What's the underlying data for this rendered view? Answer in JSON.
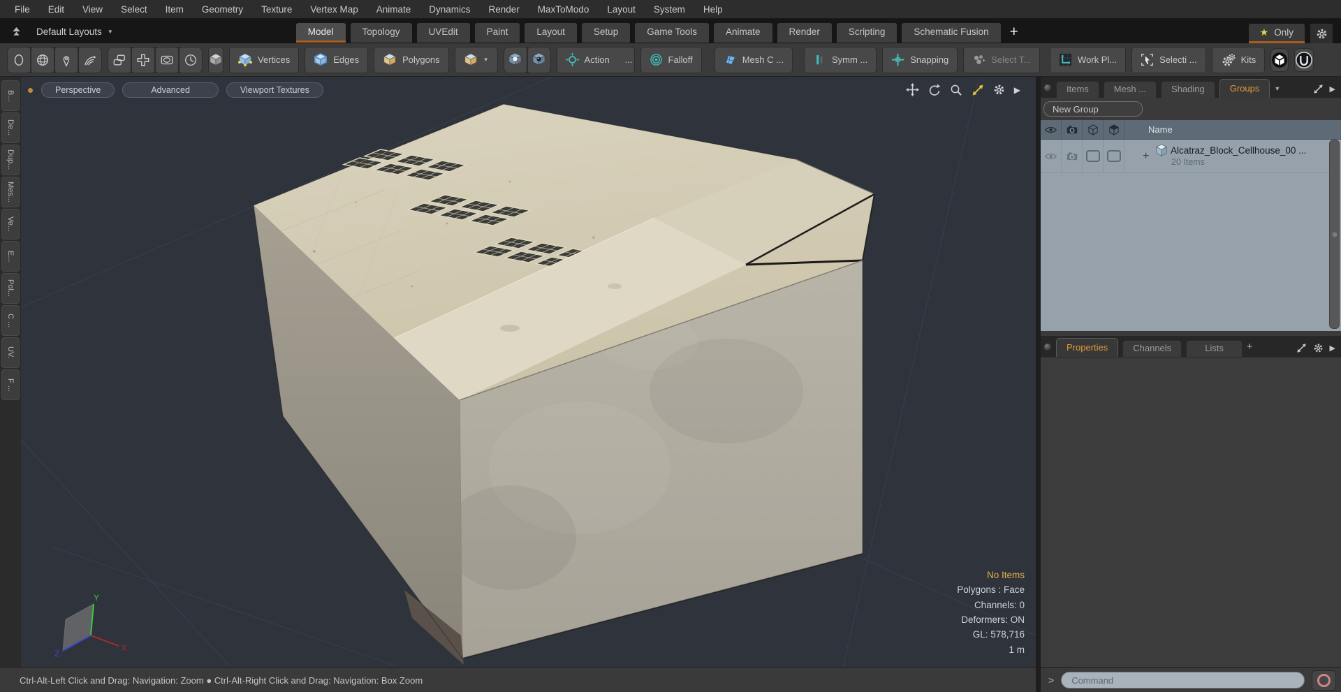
{
  "menubar": {
    "items": [
      "File",
      "Edit",
      "View",
      "Select",
      "Item",
      "Geometry",
      "Texture",
      "Vertex Map",
      "Animate",
      "Dynamics",
      "Render",
      "MaxToModo",
      "Layout",
      "System",
      "Help"
    ]
  },
  "layout_bar": {
    "switcher": "Default Layouts",
    "tabs": [
      "Model",
      "Topology",
      "UVEdit",
      "Paint",
      "Layout",
      "Setup",
      "Game Tools",
      "Animate",
      "Render",
      "Scripting",
      "Schematic Fusion"
    ],
    "active_tab": "Model",
    "add_tab": "+",
    "only": "Only"
  },
  "toolbar": {
    "vertices": "Vertices",
    "edges": "Edges",
    "polygons": "Polygons",
    "action": "Action",
    "action_ellipsis": "...",
    "falloff": "Falloff",
    "mesh_constraint": "Mesh C ...",
    "symmetry": "Symm ...",
    "snapping": "Snapping",
    "select_through": "Select T...",
    "work_plane": "Work Pl...",
    "selection_sets": "Selecti ...",
    "kits": "Kits"
  },
  "left_tabs": [
    "B...",
    "De...",
    "Dup...",
    "Mes...",
    "Ve...",
    "E...",
    "Pol...",
    "C ...",
    "UV.",
    "F ..."
  ],
  "viewport": {
    "view_mode": "Perspective",
    "shading_mode": "Advanced",
    "texture_mode": "Viewport Textures",
    "stats": {
      "selection": "No Items",
      "polygons": "Polygons : Face",
      "channels": "Channels: 0",
      "deformers": "Deformers: ON",
      "gl": "GL: 578,716",
      "scale": "1 m"
    },
    "axis": {
      "x": "X",
      "y": "Y",
      "z": "Z"
    }
  },
  "right_panel": {
    "tabs": [
      "Items",
      "Mesh ...",
      "Shading",
      "Groups"
    ],
    "active_tab": "Groups",
    "new_group": "New Group",
    "name_header": "Name",
    "group_row": {
      "expand": "+",
      "name": "Alcatraz_Block_Cellhouse_00 ...",
      "count": "20 Items"
    },
    "lower_tabs": [
      "Properties",
      "Channels",
      "Lists"
    ],
    "active_lower_tab": "Properties",
    "add_tab": "+"
  },
  "status_bar": {
    "hint": "Ctrl-Alt-Left Click and Drag: Navigation: Zoom ● Ctrl-Alt-Right Click and Drag: Navigation: Box Zoom"
  },
  "command_bar": {
    "prompt": ">",
    "placeholder": "Command"
  },
  "icons": {
    "caret_down": "▼",
    "play": "▶",
    "star": "★",
    "plus": "+"
  },
  "colors": {
    "accent_orange": "#a85e1e",
    "tab_text_orange": "#e09a3c",
    "teal": "#45bfbf",
    "viewport_bg": "#2f333c",
    "list_bg": "#97a1ab",
    "star_yellow": "#e5d44c",
    "record_ring": "#cd8686"
  }
}
